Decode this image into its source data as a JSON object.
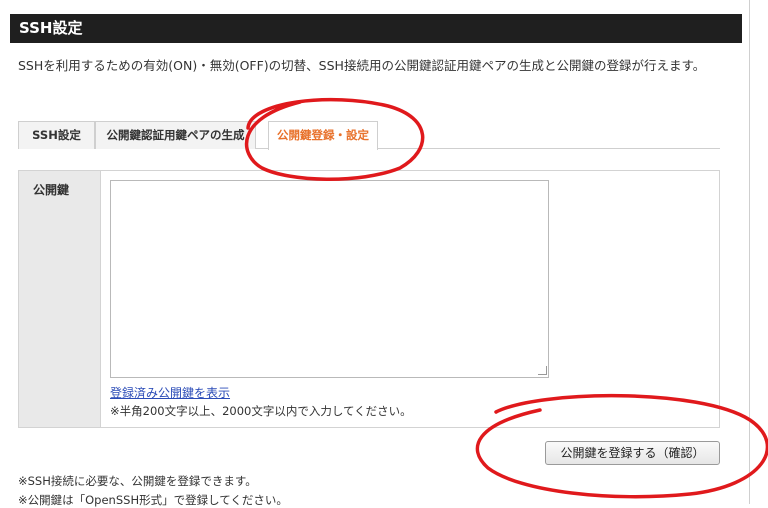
{
  "header": {
    "title": "SSH設定"
  },
  "description": "SSHを利用するための有効(ON)・無効(OFF)の切替、SSH接続用の公開鍵認証用鍵ペアの生成と公開鍵の登録が行えます。",
  "tabs": [
    {
      "label": "SSH設定"
    },
    {
      "label": "公開鍵認証用鍵ペアの生成"
    },
    {
      "label": "公開鍵登録・設定",
      "active": true
    }
  ],
  "form": {
    "label": "公開鍵",
    "textarea_value": "",
    "show_link": "登録済み公開鍵を表示",
    "note": "※半角200文字以上、2000文字以内で入力してください。"
  },
  "buttons": {
    "submit_label": "公開鍵を登録する（確認）"
  },
  "footer": {
    "line1": "※SSH接続に必要な、公開鍵を登録できます。",
    "line2": "※公開鍵は「OpenSSH形式」で登録してください。"
  },
  "colors": {
    "accent": "#e8722c",
    "annotation": "#e0191c",
    "title_bar": "#1f1f1f"
  }
}
